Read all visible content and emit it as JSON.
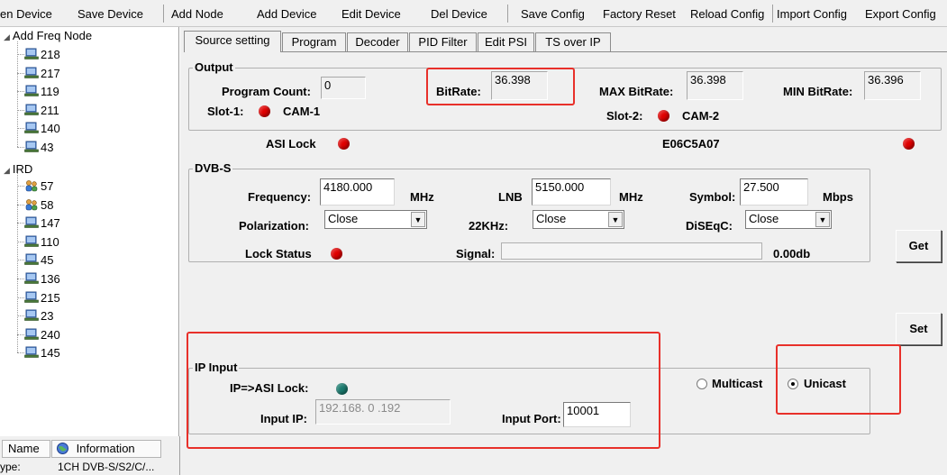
{
  "menu": [
    "en Device",
    "Save Device",
    "Add Node",
    "Add Device",
    "Edit Device",
    "Del Device",
    "Save Config",
    "Factory Reset",
    "Reload Config",
    "Import Config",
    "Export Config"
  ],
  "tree": {
    "freq_node_label": "Add Freq Node",
    "freq_items": [
      "218",
      "217",
      "119",
      "211",
      "140",
      "43"
    ],
    "ird_label": "IRD",
    "ird_items": [
      "57",
      "58",
      "147",
      "110",
      "45",
      "136",
      "215",
      "23",
      "240",
      "145"
    ],
    "footer": {
      "col_name": "Name",
      "col_info": "Information",
      "row_key": "ype:",
      "row_value": "1CH DVB-S/S2/C/..."
    }
  },
  "tabs": [
    "Source setting",
    "Program",
    "Decoder",
    "PID Filter",
    "Edit PSI",
    "TS over IP"
  ],
  "output": {
    "title": "Output",
    "program_count_label": "Program Count:",
    "program_count": "0",
    "bitrate_label": "BitRate:",
    "bitrate": "36.398",
    "max_bitrate_label": "MAX BitRate:",
    "max_bitrate": "36.398",
    "min_bitrate_label": "MIN BitRate:",
    "min_bitrate": "36.396",
    "slot1_label": "Slot-1:",
    "slot1_value": "CAM-1",
    "slot2_label": "Slot-2:",
    "slot2_value": "CAM-2"
  },
  "asi_lock_label": "ASI Lock",
  "device_code": "E06C5A07",
  "dvbs": {
    "title": "DVB-S",
    "frequency_label": "Frequency:",
    "frequency": "4180.000",
    "frequency_unit": "MHz",
    "lnb_label": "LNB",
    "lnb": "5150.000",
    "lnb_unit": "MHz",
    "symbol_label": "Symbol:",
    "symbol": "27.500",
    "symbol_unit": "Mbps",
    "polarization_label": "Polarization:",
    "polarization": "Close",
    "khz22_label": "22KHz:",
    "khz22": "Close",
    "diseqc_label": "DiSEqC:",
    "diseqc": "Close",
    "lock_status_label": "Lock Status",
    "signal_label": "Signal:",
    "signal_value": "0.00db"
  },
  "buttons": {
    "get": "Get",
    "set": "Set"
  },
  "ip_input": {
    "title": "IP Input",
    "asi_lock_label": "IP=>ASI Lock:",
    "multicast_label": "Multicast",
    "unicast_label": "Unicast",
    "input_ip_label": "Input IP:",
    "input_ip": "192.168. 0 .192",
    "input_port_label": "Input Port:",
    "input_port": "10001"
  },
  "colors": {
    "led_red": "#e00000",
    "led_green": "#1a7a6e",
    "highlight": "#e8302a"
  },
  "icons": {
    "tree_node": "computer-icon",
    "ird_node": "people-icon",
    "info": "globe-icon"
  }
}
